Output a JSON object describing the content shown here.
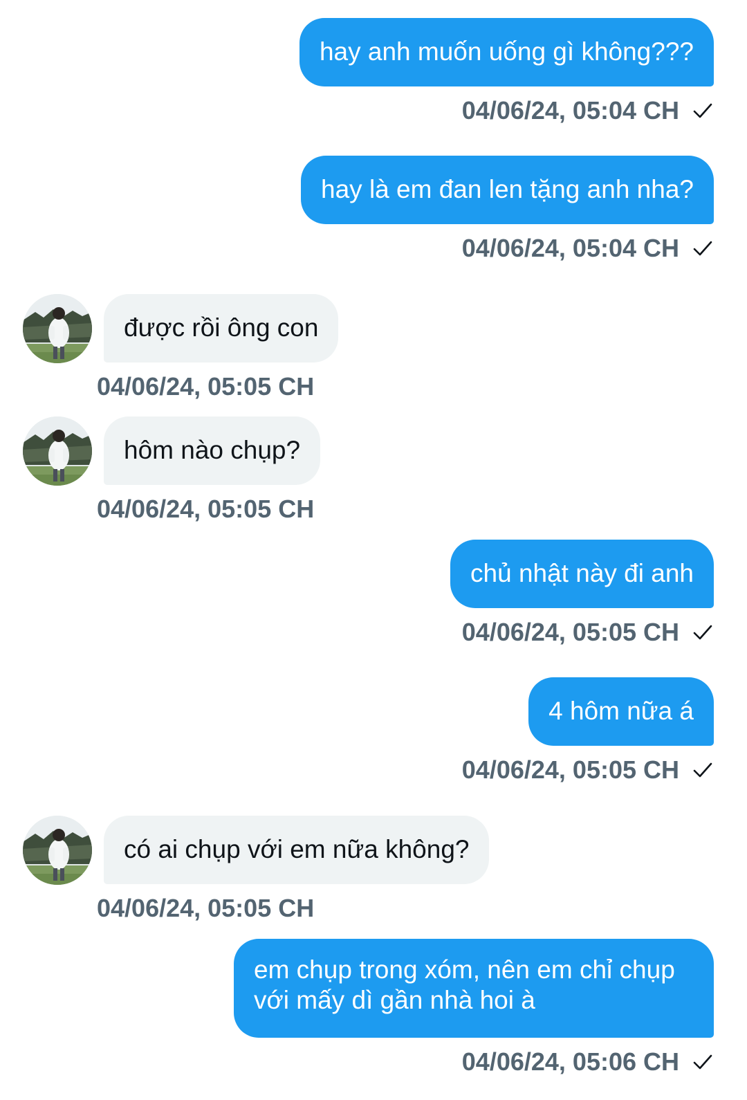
{
  "messages": [
    {
      "direction": "sent",
      "text": "hay anh muốn uống gì không???",
      "timestamp": "04/06/24, 05:04 CH"
    },
    {
      "direction": "sent",
      "text": "hay là em đan len tặng anh nha?",
      "timestamp": "04/06/24, 05:04 CH"
    },
    {
      "direction": "received",
      "text": "được rồi ông con",
      "timestamp": "04/06/24, 05:05 CH"
    },
    {
      "direction": "received",
      "text": "hôm nào chụp?",
      "timestamp": "04/06/24, 05:05 CH"
    },
    {
      "direction": "sent",
      "text": "chủ nhật này đi anh",
      "timestamp": "04/06/24, 05:05 CH"
    },
    {
      "direction": "sent",
      "text": "4 hôm nữa á",
      "timestamp": "04/06/24, 05:05 CH"
    },
    {
      "direction": "received",
      "text": "có ai chụp với em nữa không?",
      "timestamp": "04/06/24, 05:05 CH"
    },
    {
      "direction": "sent",
      "text": "em chụp trong xóm, nên em chỉ chụp với mấy dì gần nhà hoi à",
      "timestamp": "04/06/24, 05:06 CH"
    }
  ],
  "icons": {
    "sent_status": "checkmark-icon",
    "contact_avatar": "avatar-photo"
  },
  "colors": {
    "sent_bubble": "#1d9bf0",
    "received_bubble": "#eff3f4",
    "timestamp": "#536471"
  }
}
